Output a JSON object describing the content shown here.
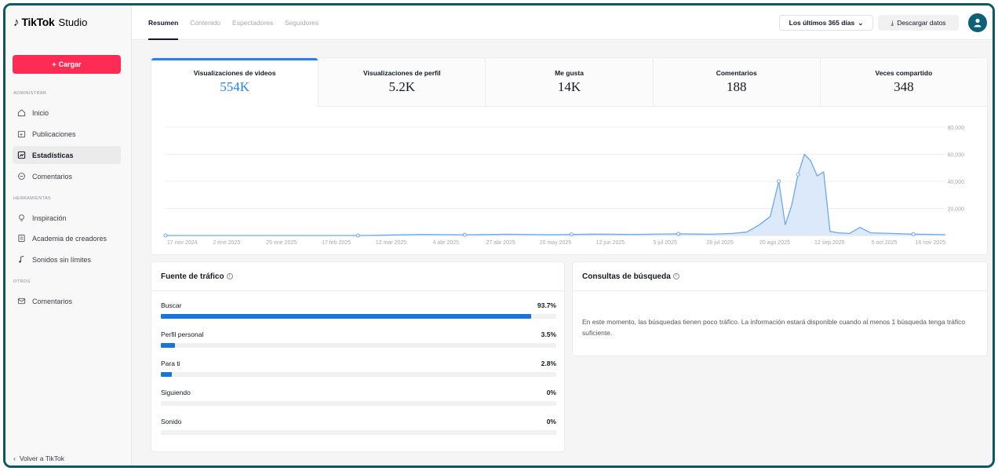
{
  "brand": {
    "logo": "TikTok",
    "product": "Studio"
  },
  "sidebar": {
    "upload_label": "Cargar",
    "sections": {
      "admin": "ADMINISTRAR",
      "tools": "HERRAMIENTAS",
      "other": "OTROS"
    },
    "items": [
      {
        "label": "Inicio",
        "icon": "home-icon"
      },
      {
        "label": "Publicaciones",
        "icon": "folder-icon"
      },
      {
        "label": "Estadísticas",
        "icon": "analytics-icon",
        "active": true
      },
      {
        "label": "Comentarios",
        "icon": "comment-icon"
      },
      {
        "label": "Inspiración",
        "icon": "lightbulb-icon"
      },
      {
        "label": "Academia de creadores",
        "icon": "book-icon"
      },
      {
        "label": "Sonidos sin límites",
        "icon": "music-note-icon"
      },
      {
        "label": "Comentarios",
        "icon": "mail-icon"
      }
    ],
    "back_label": "Volver a TikTok"
  },
  "topbar": {
    "tabs": [
      {
        "label": "Resumen",
        "active": true
      },
      {
        "label": "Contenido"
      },
      {
        "label": "Espectadores"
      },
      {
        "label": "Seguidores"
      }
    ],
    "range_label": "Los últimos 365 días",
    "download_label": "Descargar datos"
  },
  "metrics": [
    {
      "label": "Visualizaciones de videos",
      "value": "554K",
      "active": true
    },
    {
      "label": "Visualizaciones de perfil",
      "value": "5.2K"
    },
    {
      "label": "Me gusta",
      "value": "14K"
    },
    {
      "label": "Comentarios",
      "value": "188"
    },
    {
      "label": "Veces compartido",
      "value": "348"
    }
  ],
  "chart_data": {
    "type": "area",
    "x": [
      "17 nov 2024",
      "2 ene 2025",
      "25 ene 2025",
      "17 feb 2025",
      "12 mar 2025",
      "4 abr 2025",
      "27 abr 2025",
      "20 may 2025",
      "12 jun 2025",
      "5 jul 2025",
      "28 jul 2025",
      "20 ago 2025",
      "12 sep 2025",
      "5 oct 2025",
      "16 nov 2025"
    ],
    "y_ticks": [
      "20,000",
      "40,000",
      "60,000",
      "80,000"
    ],
    "ylim": [
      0,
      80000
    ],
    "grid": true,
    "series_color": "#6ea8ea",
    "points": [
      [
        0,
        0
      ],
      [
        90,
        0
      ],
      [
        100,
        200
      ],
      [
        120,
        800
      ],
      [
        140,
        500
      ],
      [
        160,
        900
      ],
      [
        180,
        600
      ],
      [
        200,
        1000
      ],
      [
        220,
        800
      ],
      [
        240,
        1200
      ],
      [
        255,
        900
      ],
      [
        265,
        1500
      ],
      [
        272,
        2500
      ],
      [
        278,
        8000
      ],
      [
        283,
        14000
      ],
      [
        287,
        40000
      ],
      [
        290,
        8000
      ],
      [
        293,
        22000
      ],
      [
        296,
        45000
      ],
      [
        299,
        60000
      ],
      [
        302,
        55000
      ],
      [
        305,
        44000
      ],
      [
        308,
        47000
      ],
      [
        311,
        3000
      ],
      [
        315,
        2000
      ],
      [
        320,
        1500
      ],
      [
        325,
        6000
      ],
      [
        330,
        2000
      ],
      [
        340,
        1500
      ],
      [
        350,
        1000
      ],
      [
        360,
        800
      ],
      [
        365,
        600
      ]
    ],
    "markers": [
      0,
      90,
      140,
      190,
      240,
      287,
      296,
      350
    ]
  },
  "traffic": {
    "title": "Fuente de tráfico",
    "rows": [
      {
        "name": "Buscar",
        "pct": "93.7%",
        "value": 93.7
      },
      {
        "name": "Perfil personal",
        "pct": "3.5%",
        "value": 3.5
      },
      {
        "name": "Para ti",
        "pct": "2.8%",
        "value": 2.8
      },
      {
        "name": "Siguiendo",
        "pct": "0%",
        "value": 0
      },
      {
        "name": "Sonido",
        "pct": "0%",
        "value": 0
      }
    ]
  },
  "search": {
    "title": "Consultas de búsqueda",
    "message": "En este momento, las búsquedas tienen poco tráfico. La información estará disponible cuando al menos 1 búsqueda tenga tráfico suficiente."
  }
}
